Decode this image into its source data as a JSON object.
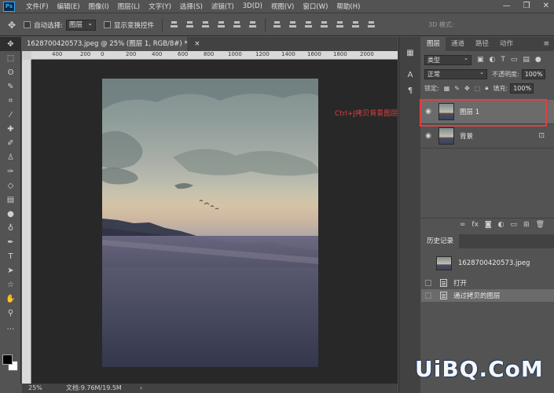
{
  "app": {
    "logo": "Ps"
  },
  "menu": [
    "文件(F)",
    "编辑(E)",
    "图像(I)",
    "图层(L)",
    "文字(Y)",
    "选择(S)",
    "滤镜(T)",
    "3D(D)",
    "视图(V)",
    "窗口(W)",
    "帮助(H)"
  ],
  "window_controls": {
    "minimize": "—",
    "restore": "❐",
    "close": "✕"
  },
  "options_bar": {
    "auto_select_label": "自动选择:",
    "auto_select_value": "图层",
    "show_transform_label": "显示变换控件",
    "mode_3d_label": "3D 模式:"
  },
  "document": {
    "tab_title": "1628700420573.jpeg @ 25% (图层 1, RGB/8#) *",
    "tab_close": "×",
    "ruler_labels": [
      "400",
      "200",
      "0",
      "200",
      "400",
      "600",
      "800",
      "1000",
      "1200",
      "1400",
      "1600",
      "1800",
      "2000"
    ]
  },
  "status": {
    "zoom": "25%",
    "doc_size": "文档:9.76M/19.5M",
    "arrow": "›"
  },
  "annotation": "Ctrl+J拷贝背景图层",
  "layers_panel": {
    "tabs": [
      "图层",
      "通道",
      "路径",
      "动作"
    ],
    "active_tab": "图层",
    "menu_icon": "≡",
    "filter_label": "类型",
    "blend_mode": "正常",
    "opacity_label": "不透明度:",
    "opacity_value": "100%",
    "lock_label": "锁定:",
    "fill_label": "填充:",
    "fill_value": "100%",
    "layers": [
      {
        "name": "图层 1",
        "selected": true
      },
      {
        "name": "背景",
        "selected": false
      }
    ]
  },
  "history_panel": {
    "title": "历史记录",
    "snapshot": "1628700420573.jpeg",
    "items": [
      {
        "label": "打开",
        "selected": false
      },
      {
        "label": "通过拷贝的图层",
        "selected": true
      }
    ]
  },
  "watermark": "UiBQ.CoM",
  "colors": {
    "annotation": "#e23e3e",
    "selected_row": "#6b6b6b",
    "panel_bg": "#535353"
  }
}
